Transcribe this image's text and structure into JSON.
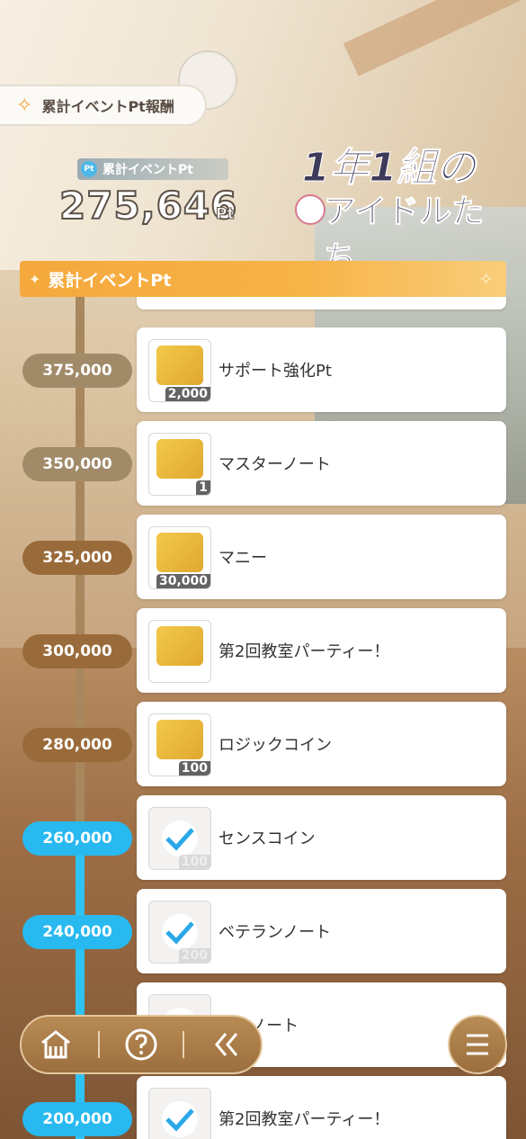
{
  "header": {
    "reward_title": "累計イベントPt報酬",
    "points_label": "累計イベントPt",
    "points_icon_text": "Pt",
    "points_value": "275,646",
    "points_unit": "Pt"
  },
  "logo": {
    "line1": "1年1組の",
    "line2": "アイドルたち"
  },
  "section": {
    "title": "累計イベントPt"
  },
  "colors": {
    "gold_badge": "#a08a68",
    "brown_badge": "#9a6b3a",
    "blue_badge": "#28b9f0",
    "accent": "#f5a83c"
  },
  "rewards": [
    {
      "threshold": "375,000",
      "name": "サポート強化Pt",
      "qty": "2,000",
      "claimed": false,
      "icon": "support-pt-icon"
    },
    {
      "threshold": "350,000",
      "name": "マスターノート",
      "qty": "1",
      "claimed": false,
      "icon": "master-note-icon"
    },
    {
      "threshold": "325,000",
      "name": "マニー",
      "qty": "30,000",
      "claimed": false,
      "icon": "money-coin-icon"
    },
    {
      "threshold": "300,000",
      "name": "第2回教室パーティー！",
      "qty": "",
      "claimed": false,
      "icon": "card-illustration"
    },
    {
      "threshold": "280,000",
      "name": "ロジックコイン",
      "qty": "100",
      "claimed": false,
      "icon": "logic-coin-icon"
    },
    {
      "threshold": "260,000",
      "name": "センスコイン",
      "qty": "100",
      "claimed": true,
      "icon": "sense-coin-icon"
    },
    {
      "threshold": "240,000",
      "name": "ベテランノート",
      "qty": "200",
      "claimed": true,
      "icon": "veteran-note-icon"
    },
    {
      "threshold": "",
      "name": "スンノート",
      "qty": "",
      "claimed": true,
      "icon": "lesson-note-icon"
    },
    {
      "threshold": "200,000",
      "name": "第2回教室パーティー！",
      "qty": "",
      "claimed": true,
      "icon": "card-illustration"
    }
  ],
  "nav": {
    "home": "home-icon",
    "help": "help-icon",
    "back": "back-icon",
    "menu": "menu-icon"
  }
}
